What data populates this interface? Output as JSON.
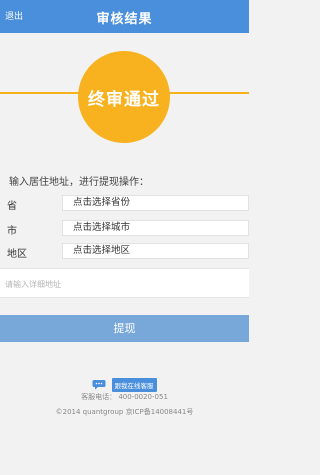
{
  "header": {
    "back_label": "退出",
    "title": "审核结果",
    "background": "#4a8fdc"
  },
  "status": {
    "text": "终审通过",
    "color": "#f8b21f"
  },
  "form": {
    "instruction": "输入居住地址，进行提现操作：",
    "province": {
      "label": "省",
      "value": "点击选择省份"
    },
    "city": {
      "label": "市",
      "value": "点击选择城市"
    },
    "district": {
      "label": "地区",
      "value": "点击选择地区"
    },
    "detail_placeholder": "请输入详细地址"
  },
  "withdraw_label": "提现",
  "support": {
    "icon": "chat-bubble-icon",
    "chat_label": "跟我在线客服",
    "phone_label": "客服电话：",
    "phone_number": "400-0020-051",
    "copyright": "©2014 quantgroup 京ICP备14008441号"
  }
}
